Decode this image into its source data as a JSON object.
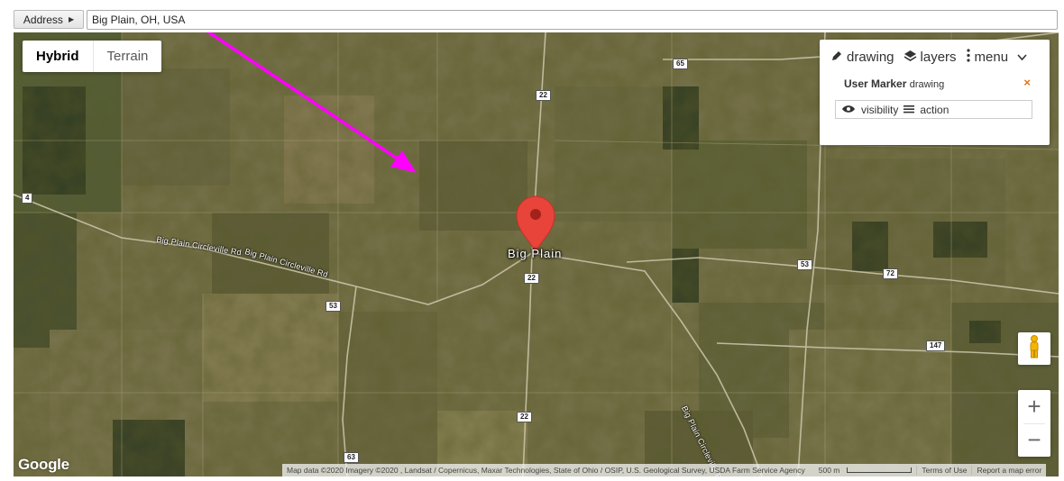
{
  "address": {
    "button_label": "Address",
    "value": "Big Plain, OH, USA"
  },
  "map_type": {
    "options": [
      "Hybrid",
      "Terrain"
    ],
    "selected": "Hybrid"
  },
  "drawing_panel": {
    "menu": {
      "drawing": "drawing",
      "layers": "layers",
      "menu": "menu"
    },
    "layer": {
      "name": "User Marker",
      "type": "drawing",
      "visibility": "visibility",
      "action": "action"
    },
    "close_symbol": "×"
  },
  "map": {
    "town": "Big Plain",
    "roads": [
      {
        "label": "Big Plain Circleville Rd"
      },
      {
        "label": "Big Plain Circleville Rd"
      },
      {
        "label": "Big Plain Circleville Rd"
      }
    ],
    "shields": [
      "65",
      "22",
      "22",
      "22",
      "53",
      "72",
      "147",
      "53",
      "63",
      "4",
      "63"
    ],
    "marker_color": "#e8443a",
    "annotation_arrow_color": "#ff00ff"
  },
  "controls": {
    "zoom_in": "+",
    "zoom_out": "−",
    "street_view": "pegman-icon"
  },
  "footer": {
    "logo": "Google",
    "attribution": "Map data ©2020 Imagery ©2020 , Landsat / Copernicus, Maxar Technologies, State of Ohio / OSIP, U.S. Geological Survey, USDA Farm Service Agency",
    "scale": "500 m",
    "terms": "Terms of Use",
    "report": "Report a map error"
  }
}
